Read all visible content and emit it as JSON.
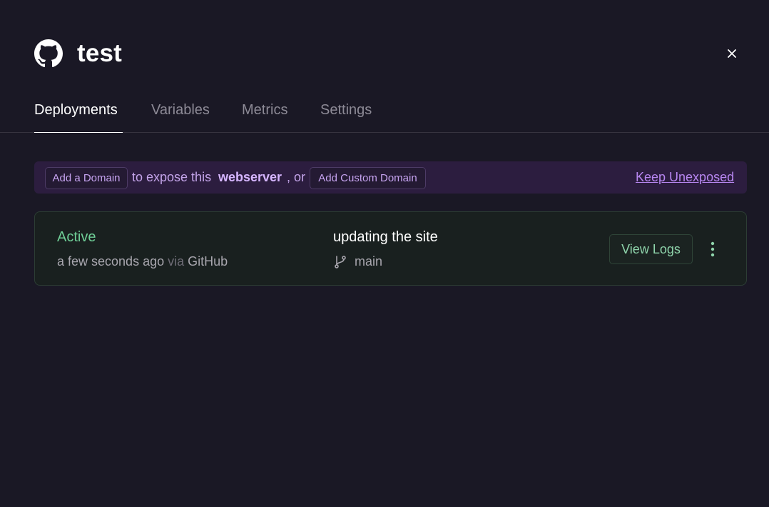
{
  "header": {
    "title": "test",
    "icon": "github-icon"
  },
  "close": {
    "icon": "close-icon"
  },
  "tabs": [
    {
      "label": "Deployments",
      "active": true
    },
    {
      "label": "Variables",
      "active": false
    },
    {
      "label": "Metrics",
      "active": false
    },
    {
      "label": "Settings",
      "active": false
    }
  ],
  "banner": {
    "add_domain_label": "Add a Domain",
    "text_1": "to expose this",
    "service_name": "webserver",
    "text_2": ", or",
    "add_custom_label": "Add Custom Domain",
    "keep_unexposed_label": "Keep Unexposed"
  },
  "deployment": {
    "status": "Active",
    "time": "a few seconds ago",
    "via": "via",
    "source": "GitHub",
    "commit_message": "updating the site",
    "branch": "main",
    "branch_icon": "git-branch-icon",
    "view_logs_label": "View Logs",
    "more_icon": "more-vertical-icon"
  },
  "colors": {
    "background": "#1a1825",
    "active_status": "#6fcf97",
    "banner_bg": "#2c1d3f",
    "link_purple": "#b786f0"
  }
}
